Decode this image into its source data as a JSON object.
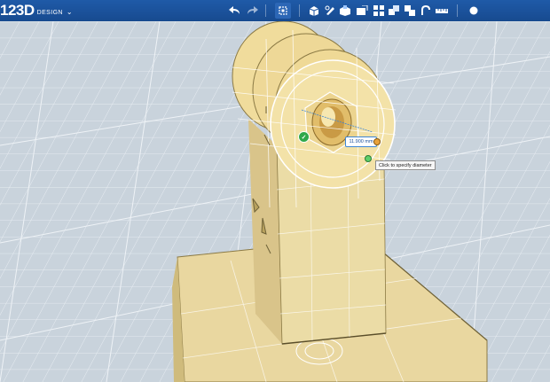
{
  "app": {
    "logo_number": "123D",
    "logo_word": "DESIGN",
    "menu_caret": "⌄"
  },
  "toolbar": {
    "icons": [
      "undo-icon",
      "redo-icon",
      "transform-icon",
      "primitives-icon",
      "sketch-icon",
      "construct-icon",
      "modify-icon",
      "pattern-icon",
      "group-icon",
      "combine-icon",
      "snap-icon",
      "measure-icon",
      "material-icon"
    ]
  },
  "dimension": {
    "value": "11.900 mm",
    "confirm_symbol": "✓"
  },
  "tooltip": {
    "text": "Click to specify diameter"
  },
  "colors": {
    "toolbar_blue": "#1b52a0",
    "grid_background": "#c9d3dc",
    "model_fill": "#e8d79a",
    "highlight": "#ffffff"
  }
}
